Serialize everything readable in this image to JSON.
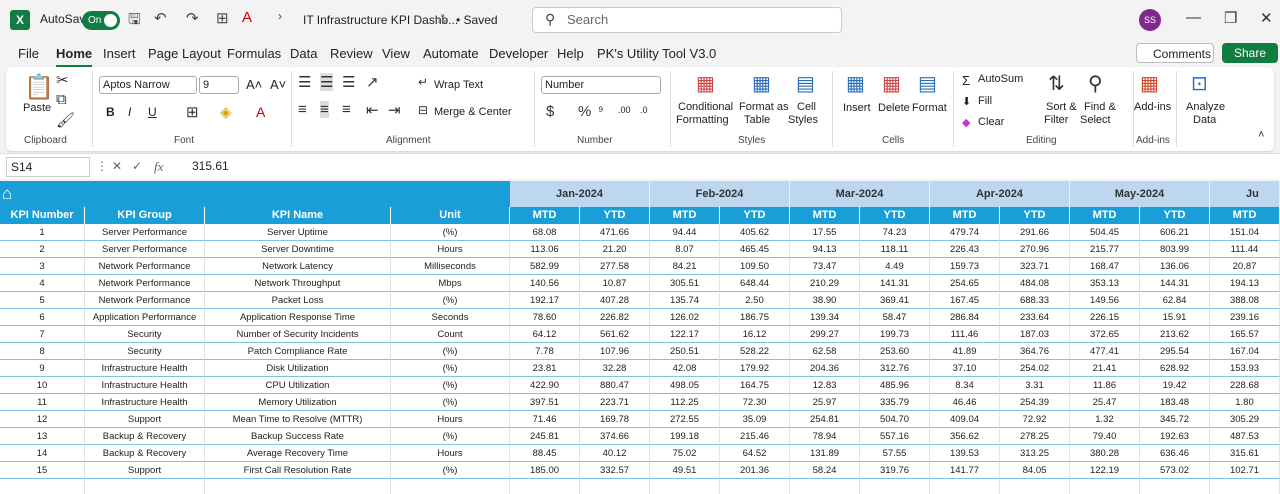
{
  "title_bar": {
    "autosave_label": "AutoSave",
    "toggle_label": "On",
    "doc_title": "IT Infrastructure KPI Dashb...",
    "saved_label": "• Saved",
    "search_placeholder": "Search",
    "avatar_initials": "SS"
  },
  "menu": {
    "tabs": [
      "File",
      "Home",
      "Insert",
      "Page Layout",
      "Formulas",
      "Data",
      "Review",
      "View",
      "Automate",
      "Developer",
      "Help",
      "PK's Utility Tool V3.0"
    ],
    "active": "Home",
    "comments_label": "Comments",
    "share_label": "Share"
  },
  "ribbon": {
    "clipboard": {
      "paste": "Paste",
      "label": "Clipboard"
    },
    "font": {
      "name": "Aptos Narrow",
      "size": "9",
      "label": "Font"
    },
    "alignment": {
      "wrap": "Wrap Text",
      "merge": "Merge & Center",
      "label": "Alignment"
    },
    "number": {
      "format": "Number",
      "label": "Number"
    },
    "styles": {
      "cond1": "Conditional",
      "cond2": "Formatting",
      "fmt1": "Format as",
      "fmt2": "Table",
      "cell1": "Cell",
      "cell2": "Styles",
      "label": "Styles"
    },
    "cells": {
      "insert": "Insert",
      "delete": "Delete",
      "format": "Format",
      "label": "Cells"
    },
    "editing": {
      "autosum": "AutoSum",
      "fill": "Fill",
      "clear": "Clear",
      "sort1": "Sort &",
      "sort2": "Filter",
      "find1": "Find &",
      "find2": "Select",
      "label": "Editing"
    },
    "addins": {
      "btn": "Add-ins",
      "label": "Add-ins"
    },
    "analyze": {
      "a1": "Analyze",
      "a2": "Data"
    }
  },
  "formula_bar": {
    "cell_ref": "S14",
    "value": "315.61"
  },
  "sheet": {
    "months": [
      "Jan-2024",
      "Feb-2024",
      "Mar-2024",
      "Apr-2024",
      "May-2024",
      "Ju"
    ],
    "headers": [
      "KPI Number",
      "KPI Group",
      "KPI Name",
      "Unit",
      "MTD",
      "YTD",
      "MTD",
      "YTD",
      "MTD",
      "YTD",
      "MTD",
      "YTD",
      "MTD",
      "YTD",
      "MTD"
    ],
    "rows": [
      [
        "1",
        "Server Performance",
        "Server Uptime",
        "(%)",
        "68.08",
        "471.66",
        "94.44",
        "405.62",
        "17.55",
        "74.23",
        "479.74",
        "291.66",
        "504.45",
        "606.21",
        "151.04"
      ],
      [
        "2",
        "Server Performance",
        "Server Downtime",
        "Hours",
        "113.06",
        "21.20",
        "8.07",
        "465.45",
        "94.13",
        "118.11",
        "226.43",
        "270.96",
        "215.77",
        "803.99",
        "111.44"
      ],
      [
        "3",
        "Network Performance",
        "Network Latency",
        "Milliseconds",
        "582.99",
        "277.58",
        "84.21",
        "109.50",
        "73.47",
        "4.49",
        "159.73",
        "323.71",
        "168.47",
        "136.06",
        "20.87"
      ],
      [
        "4",
        "Network Performance",
        "Network Throughput",
        "Mbps",
        "140.56",
        "10.87",
        "305.51",
        "648.44",
        "210.29",
        "141.31",
        "254.65",
        "484.08",
        "353.13",
        "144.31",
        "194.13"
      ],
      [
        "5",
        "Network Performance",
        "Packet Loss",
        "(%)",
        "192.17",
        "407.28",
        "135.74",
        "2.50",
        "38.90",
        "369.41",
        "167.45",
        "688.33",
        "149.56",
        "62.84",
        "388.08"
      ],
      [
        "6",
        "Application Performance",
        "Application Response Time",
        "Seconds",
        "78.60",
        "226.82",
        "126.02",
        "186.75",
        "139.34",
        "58.47",
        "286.84",
        "233.64",
        "226.15",
        "15.91",
        "239.16"
      ],
      [
        "7",
        "Security",
        "Number of Security Incidents",
        "Count",
        "64.12",
        "561.62",
        "122.17",
        "16.12",
        "299.27",
        "199.73",
        "111.46",
        "187.03",
        "372.65",
        "213.62",
        "165.57"
      ],
      [
        "8",
        "Security",
        "Patch Compliance Rate",
        "(%)",
        "7.78",
        "107.96",
        "250.51",
        "528.22",
        "62.58",
        "253.60",
        "41.89",
        "364.76",
        "477.41",
        "295.54",
        "167.04"
      ],
      [
        "9",
        "Infrastructure Health",
        "Disk Utilization",
        "(%)",
        "23.81",
        "32.28",
        "42.08",
        "179.92",
        "204.36",
        "312.76",
        "37.10",
        "254.02",
        "21.41",
        "628.92",
        "153.93"
      ],
      [
        "10",
        "Infrastructure Health",
        "CPU Utilization",
        "(%)",
        "422.90",
        "880.47",
        "498.05",
        "164.75",
        "12.83",
        "485.96",
        "8.34",
        "3.31",
        "11.86",
        "19.42",
        "228.68"
      ],
      [
        "11",
        "Infrastructure Health",
        "Memory Utilization",
        "(%)",
        "397.51",
        "223.71",
        "112.25",
        "72.30",
        "25.97",
        "335.79",
        "46.46",
        "254.39",
        "25.47",
        "183.48",
        "1.80"
      ],
      [
        "12",
        "Support",
        "Mean Time to Resolve (MTTR)",
        "Hours",
        "71.46",
        "169.78",
        "272.55",
        "35.09",
        "254.81",
        "504.70",
        "409.04",
        "72.92",
        "1.32",
        "345.72",
        "305.29"
      ],
      [
        "13",
        "Backup & Recovery",
        "Backup Success Rate",
        "(%)",
        "245.81",
        "374.66",
        "199.18",
        "215.46",
        "78.94",
        "557.16",
        "356.62",
        "278.25",
        "79.40",
        "192.63",
        "487.53"
      ],
      [
        "14",
        "Backup & Recovery",
        "Average Recovery Time",
        "Hours",
        "88.45",
        "40.12",
        "75.02",
        "64.52",
        "131.89",
        "57.55",
        "139.53",
        "313.25",
        "380.28",
        "636.46",
        "315.61"
      ],
      [
        "15",
        "Support",
        "First Call Resolution Rate",
        "(%)",
        "185.00",
        "332.57",
        "49.51",
        "201.36",
        "58.24",
        "319.76",
        "141.77",
        "84.05",
        "122.19",
        "573.02",
        "102.71"
      ]
    ]
  }
}
